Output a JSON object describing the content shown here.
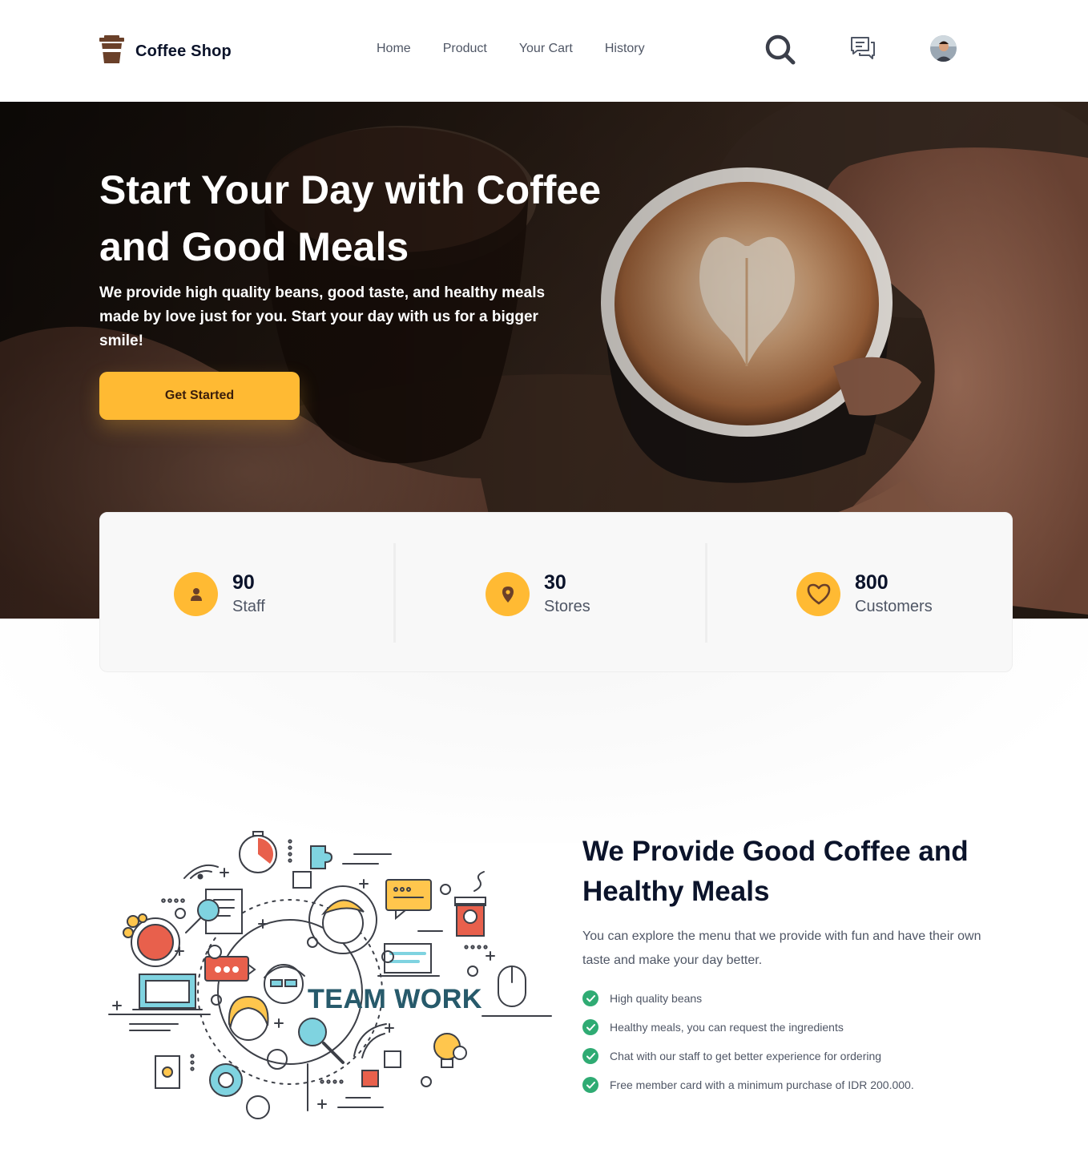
{
  "brand": {
    "name": "Coffee Shop",
    "logo_icon": "coffee-cup-icon"
  },
  "nav": {
    "links": [
      "Home",
      "Product",
      "Your Cart",
      "History"
    ],
    "icons": [
      "search-icon",
      "chat-icon"
    ],
    "avatar": "user-avatar"
  },
  "hero": {
    "title": "Start Your Day with Coffee and Good Meals",
    "subtitle": "We provide high quality beans, good taste, and healthy meals made by love just for you. Start your day with us for a bigger smile!",
    "cta_label": "Get Started"
  },
  "stats": [
    {
      "value": "90",
      "label": "Staff",
      "icon": "person-icon"
    },
    {
      "value": "30",
      "label": "Stores",
      "icon": "location-pin-icon"
    },
    {
      "value": "800",
      "label": "Customers",
      "icon": "heart-icon"
    }
  ],
  "info": {
    "illustration_text": "TEAM WORK",
    "title": "We Provide Good Coffee and Healthy Meals",
    "description": "You can explore the menu that we provide with fun and have their own taste and make your day better.",
    "features": [
      "High quality beans",
      "Healthy meals, you can request the ingredients",
      "Chat with our staff to get better experience for ordering",
      "Free member card with a minimum purchase of IDR 200.000."
    ]
  },
  "colors": {
    "accent": "#ffba33",
    "dark": "#0b132a",
    "text": "#4f5665",
    "check": "#2fab73",
    "brown": "#6a4029"
  }
}
